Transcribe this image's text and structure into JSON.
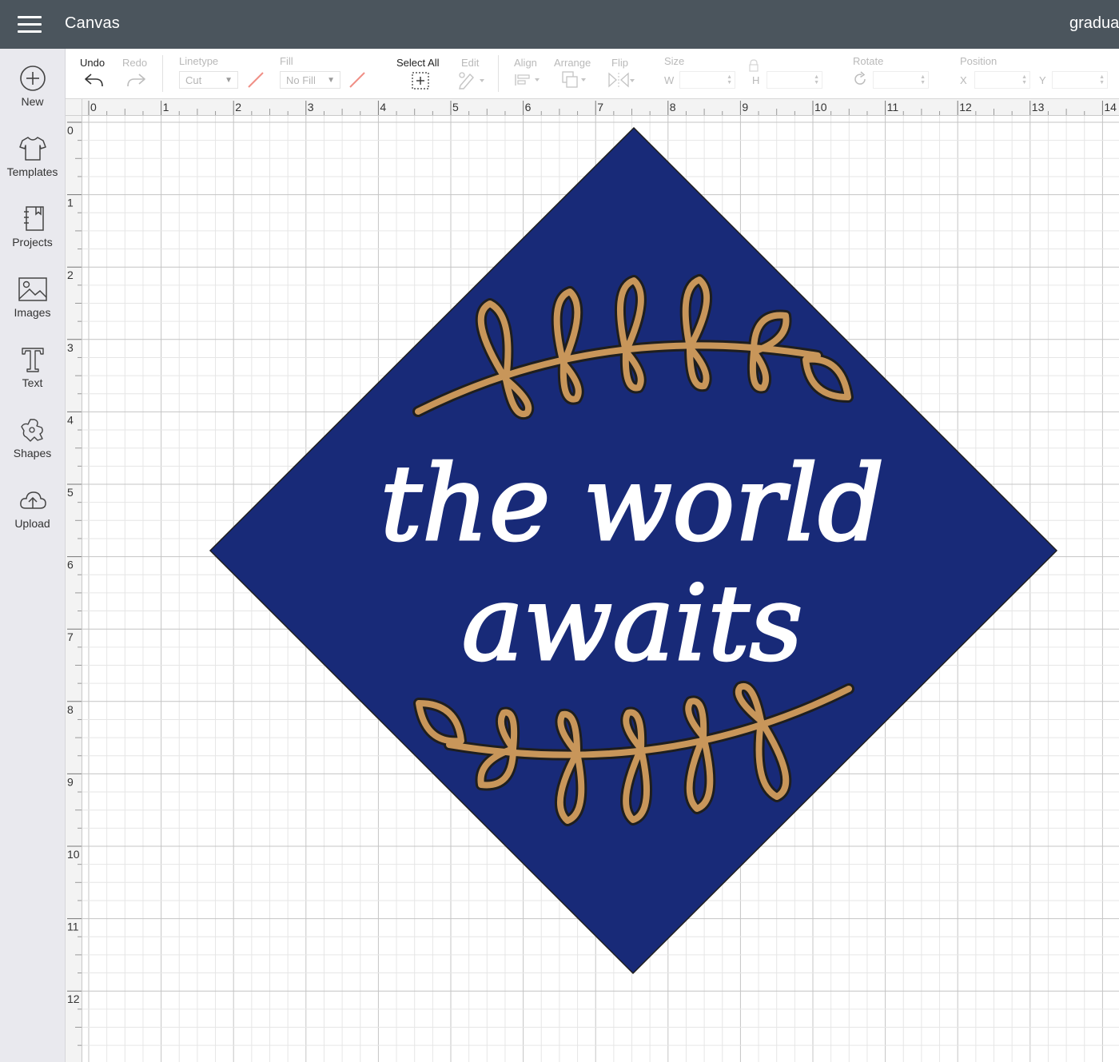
{
  "header": {
    "app_title": "Canvas",
    "project_name": "graduat",
    "background": "#4b555d"
  },
  "sidebar": {
    "items": [
      {
        "id": "new",
        "label": "New",
        "icon": "plus-circle-icon"
      },
      {
        "id": "templates",
        "label": "Templates",
        "icon": "tshirt-icon"
      },
      {
        "id": "projects",
        "label": "Projects",
        "icon": "notebook-icon"
      },
      {
        "id": "images",
        "label": "Images",
        "icon": "image-icon"
      },
      {
        "id": "text",
        "label": "Text",
        "icon": "text-t-icon"
      },
      {
        "id": "shapes",
        "label": "Shapes",
        "icon": "shapes-icon"
      },
      {
        "id": "upload",
        "label": "Upload",
        "icon": "cloud-upload-icon"
      }
    ]
  },
  "toolbar": {
    "undo_label": "Undo",
    "redo_label": "Redo",
    "linetype_label": "Linetype",
    "linetype_value": "Cut",
    "fill_label": "Fill",
    "fill_value": "No Fill",
    "select_all_label": "Select All",
    "edit_label": "Edit",
    "align_label": "Align",
    "arrange_label": "Arrange",
    "flip_label": "Flip",
    "size_label": "Size",
    "size_w_letter": "W",
    "size_h_letter": "H",
    "rotate_label": "Rotate",
    "position_label": "Position",
    "position_x_letter": "X",
    "position_y_letter": "Y"
  },
  "rulers": {
    "horizontal": [
      "0",
      "1",
      "2",
      "3",
      "4",
      "5",
      "6",
      "7",
      "8",
      "9",
      "10",
      "11",
      "12",
      "13",
      "14"
    ],
    "vertical": [
      "0",
      "1",
      "2",
      "3",
      "4",
      "5",
      "6",
      "7",
      "8",
      "9",
      "10",
      "11",
      "12"
    ]
  },
  "design": {
    "lines": [
      "the world",
      "awaits"
    ],
    "colors": {
      "diamond": "#182a78",
      "laurel": "#c8965a",
      "lettering": "#ffffff",
      "outline": "#1e1e1e",
      "grid_minor": "#e6e6e6",
      "grid_major": "#c4c4c4"
    }
  }
}
